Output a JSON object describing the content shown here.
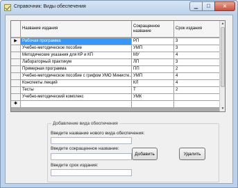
{
  "window": {
    "title": "Справочник: Виды обеспечения"
  },
  "grid": {
    "columns": [
      "Название издания",
      "Сокращенное название",
      "Срок издания"
    ],
    "current_row_marker": "▶",
    "new_row_marker": "✱",
    "rows": [
      {
        "name": "Рабочая программа",
        "abbr": "РП",
        "term": "3"
      },
      {
        "name": "Учебно-методическое пособие",
        "abbr": "УМП",
        "term": "3"
      },
      {
        "name": "Методические указания для КР и КП",
        "abbr": "МУ",
        "term": "4"
      },
      {
        "name": "Лабораторный практикум",
        "abbr": "ЛП",
        "term": "3"
      },
      {
        "name": "Примерная программа",
        "abbr": "ПП",
        "term": "2"
      },
      {
        "name": "Учебно-методическое пособие с грифом УМО Министе...",
        "abbr": "УМП",
        "term": "4"
      },
      {
        "name": "Конспекты лекций",
        "abbr": "КЛ",
        "term": "4"
      },
      {
        "name": "Тесты",
        "abbr": "Т",
        "term": "2"
      },
      {
        "name": "Учебно-методический комплекс",
        "abbr": "УМК",
        "term": ""
      }
    ]
  },
  "form": {
    "group_title": "Добавление вида обеспечения",
    "name_label": "Введите название нового вида обеспечения:",
    "abbr_label": "Введите сокращенное название:",
    "term_label": "Введите срок издания:",
    "name_value": "",
    "abbr_value": "",
    "term_value": "",
    "add_button": "Добавить",
    "delete_button": "Удалить"
  }
}
